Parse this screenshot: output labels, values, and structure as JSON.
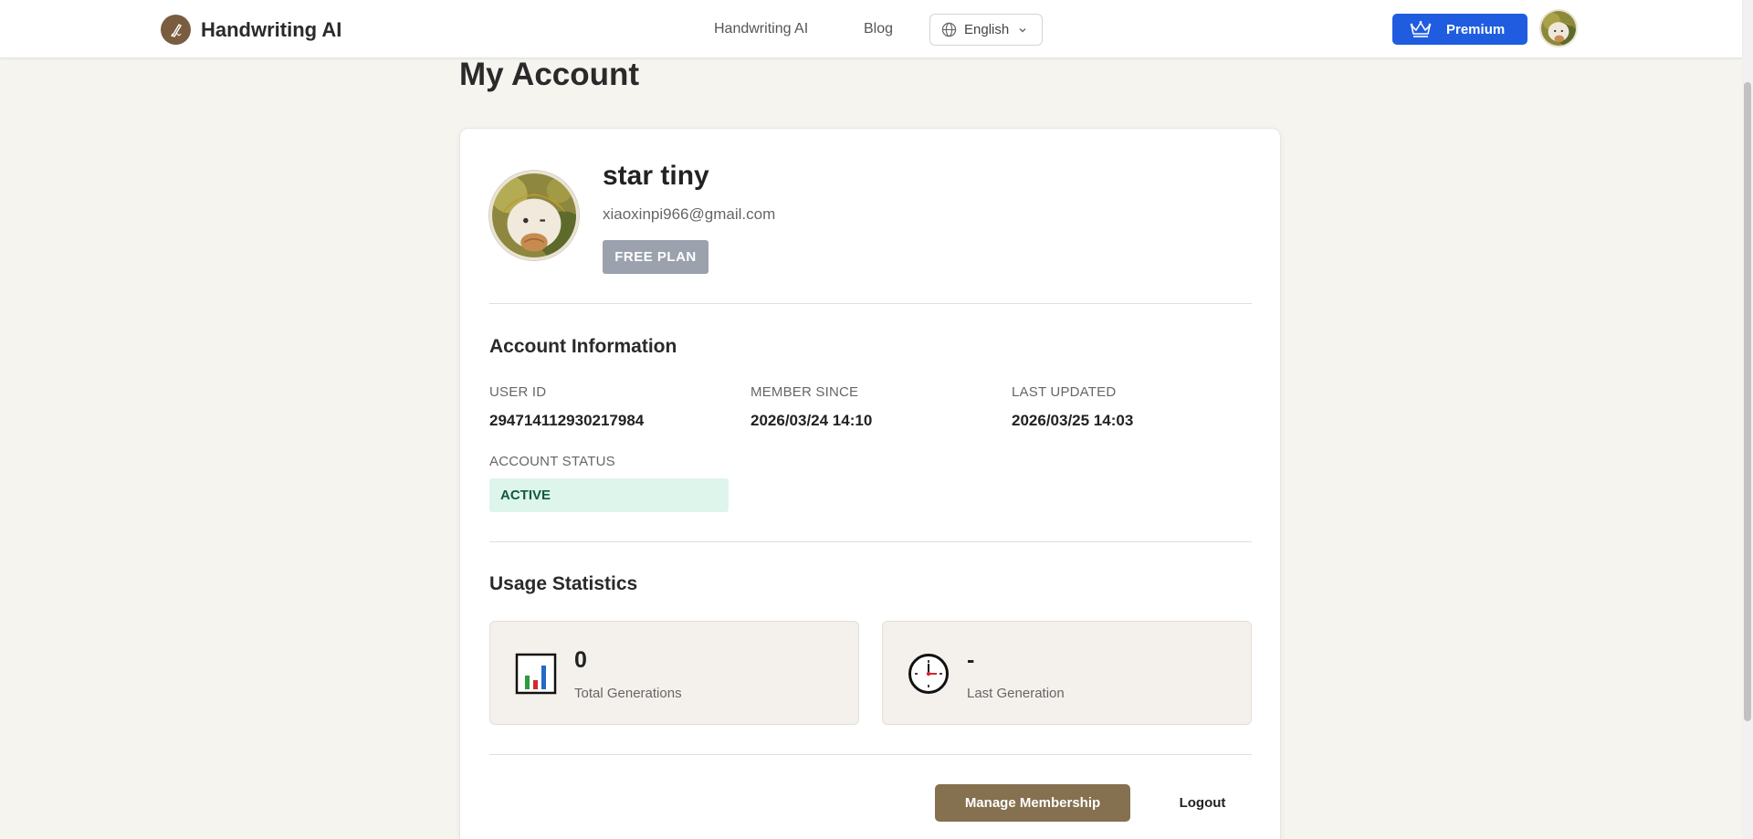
{
  "header": {
    "brand_name": "Handwriting AI",
    "nav": [
      {
        "label": "Handwriting AI"
      },
      {
        "label": "Blog"
      }
    ],
    "language": {
      "selected": "English"
    },
    "premium_label": "Premium"
  },
  "page": {
    "title": "My Account"
  },
  "profile": {
    "name": "star tiny",
    "email": "xiaoxinpi966@gmail.com",
    "plan": "FREE PLAN"
  },
  "account_info": {
    "title": "Account Information",
    "user_id": {
      "label": "USER ID",
      "value": "294714112930217984"
    },
    "member_since": {
      "label": "MEMBER SINCE",
      "value": "2026/03/24 14:10"
    },
    "last_updated": {
      "label": "LAST UPDATED",
      "value": "2026/03/25 14:03"
    },
    "status": {
      "label": "ACCOUNT STATUS",
      "value": "ACTIVE"
    }
  },
  "usage": {
    "title": "Usage Statistics",
    "total_generations": {
      "value": "0",
      "label": "Total Generations"
    },
    "last_generation": {
      "value": "-",
      "label": "Last Generation"
    }
  },
  "actions": {
    "manage_label": "Manage Membership",
    "logout_label": "Logout"
  },
  "colors": {
    "background": "#f6f4ef",
    "premium": "#1f5ce0",
    "brand": "#7a5c3f",
    "manage_button": "#85704f",
    "plan_badge": "#9ba1ad",
    "status_active_bg": "#def5ec",
    "status_active_text": "#0f5a3f"
  },
  "icons": {
    "brand": "pen-icon",
    "language": "globe-icon",
    "premium": "crown-icon",
    "total_generations": "bar-chart-icon",
    "last_generation": "clock-icon"
  }
}
